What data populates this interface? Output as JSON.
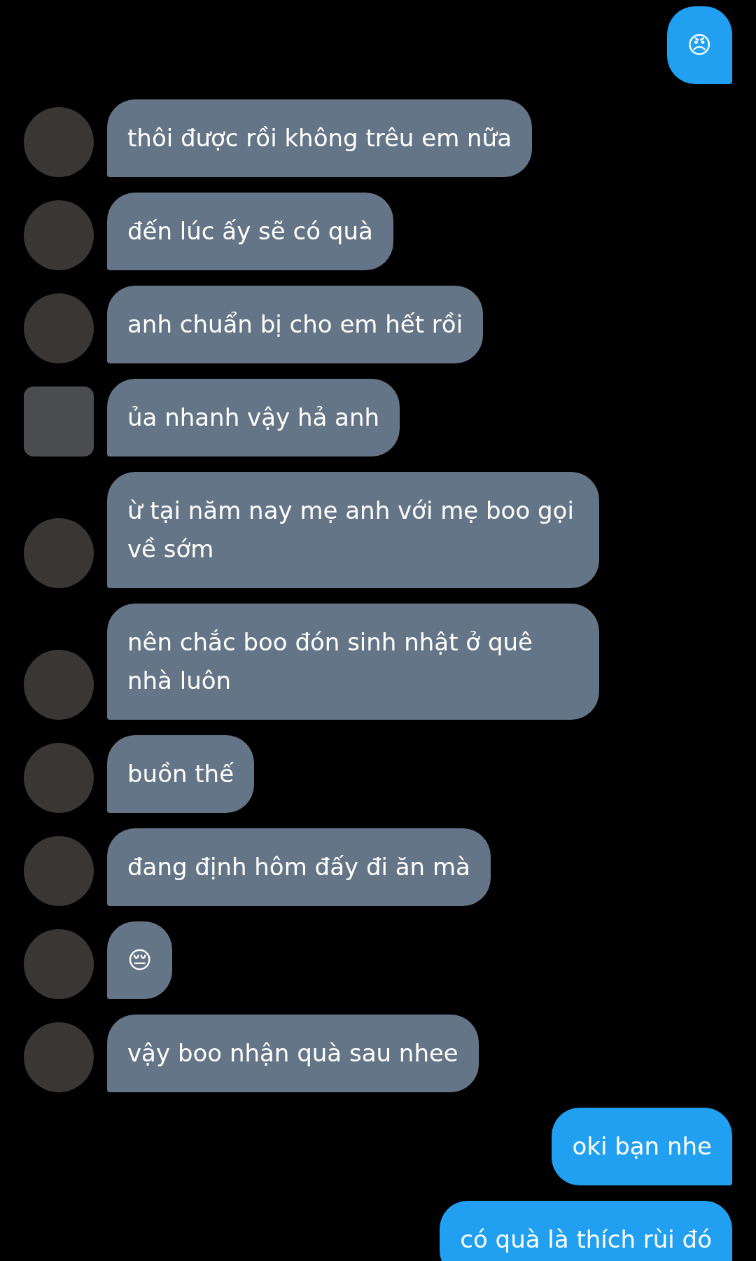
{
  "messages": [
    {
      "kind": "sent",
      "text": "😠"
    },
    {
      "kind": "received",
      "avatar": {
        "kind": "circle"
      },
      "text": "thôi được rồi không trêu em nữa"
    },
    {
      "kind": "received",
      "avatar": {
        "kind": "circle"
      },
      "text": "đến lúc ấy sẽ có quà"
    },
    {
      "kind": "received",
      "avatar": {
        "kind": "circle"
      },
      "text": "anh chuẩn bị cho em hết rồi"
    },
    {
      "kind": "received",
      "avatar": {
        "kind": "square"
      },
      "text": "ủa nhanh vậy hả anh"
    },
    {
      "kind": "received",
      "avatar": {
        "kind": "circle"
      },
      "text": "ừ tại năm nay mẹ anh với mẹ boo gọi về sớm"
    },
    {
      "kind": "received",
      "avatar": {
        "kind": "circle"
      },
      "text": "nên chắc boo đón sinh nhật ở quê nhà luôn"
    },
    {
      "kind": "received",
      "avatar": {
        "kind": "circle"
      },
      "text": "buồn thế"
    },
    {
      "kind": "received",
      "avatar": {
        "kind": "circle"
      },
      "text": "đang định hôm đấy đi ăn mà"
    },
    {
      "kind": "received",
      "avatar": {
        "kind": "circle"
      },
      "text": "😔"
    },
    {
      "kind": "received",
      "avatar": {
        "kind": "circle"
      },
      "text": "vậy boo nhận quà sau nhee"
    },
    {
      "kind": "sent",
      "text": "oki bạn nhe"
    },
    {
      "kind": "sent",
      "text": "có quà là thích rùi đó"
    }
  ]
}
